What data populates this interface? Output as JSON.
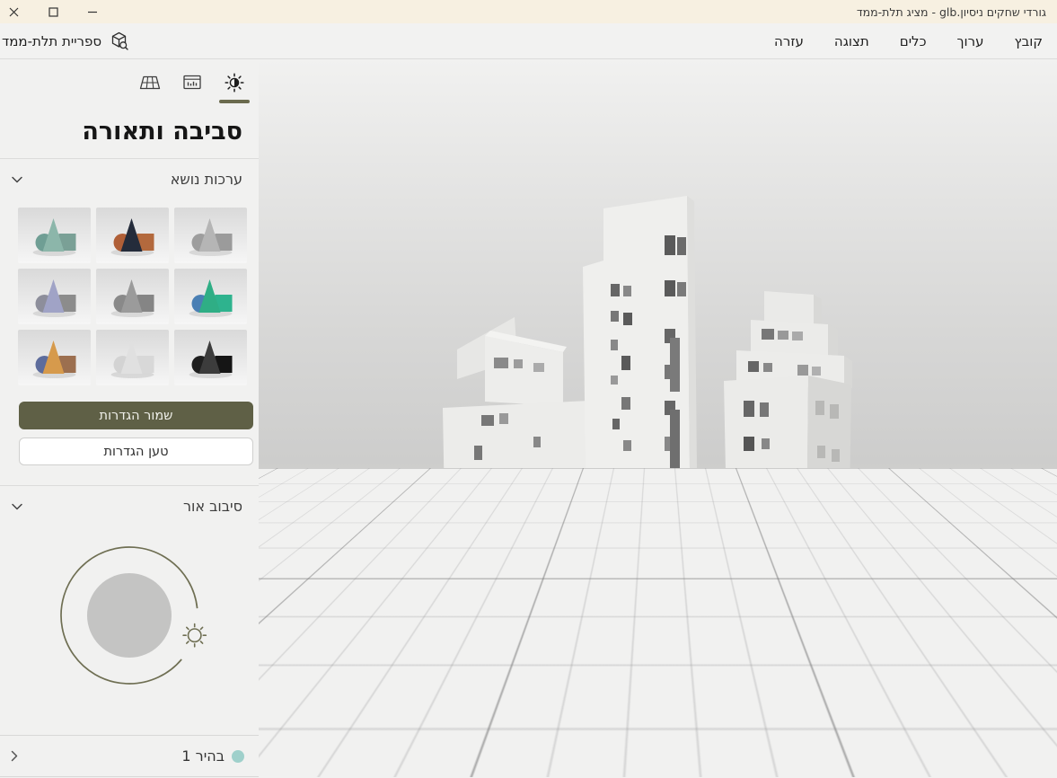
{
  "window": {
    "title": "גורדי שחקים ניסיון.glb - מציג תלת-ממד",
    "titlebar_color": "#f7f0e1"
  },
  "menubar": {
    "items": [
      {
        "label": "קובץ"
      },
      {
        "label": "ערוך"
      },
      {
        "label": "כלים"
      },
      {
        "label": "תצוגה"
      },
      {
        "label": "עזרה"
      }
    ],
    "library_label": "ספריית תלת-ממד"
  },
  "sidebar": {
    "tabs": [
      {
        "name": "lighting",
        "icon": "sun-icon",
        "active": true
      },
      {
        "name": "stats",
        "icon": "stats-panel-icon",
        "active": false
      },
      {
        "name": "grid",
        "icon": "ground-grid-icon",
        "active": false
      }
    ],
    "title": "סביבה ותאורה",
    "themes": {
      "label": "ערכות נושא",
      "tiles": [
        {
          "name": "sage",
          "sphere": "#6f9e94",
          "cone": "#8cb6aa",
          "cube": "#7aa096"
        },
        {
          "name": "rust-navy",
          "sphere": "#b05f37",
          "cone": "#242c3b",
          "cube": "#b3693d"
        },
        {
          "name": "gray",
          "sphere": "#9d9d9d",
          "cone": "#b5b5b5",
          "cube": "#9b9b9b"
        },
        {
          "name": "lavender",
          "sphere": "#8d8e9b",
          "cone": "#a0a3c6",
          "cube": "#8c8c8c"
        },
        {
          "name": "dark-gray",
          "sphere": "#898989",
          "cone": "#9b9b9b",
          "cube": "#858585"
        },
        {
          "name": "green",
          "sphere": "#4a7fb4",
          "cone": "#2fae85",
          "cube": "#2eb38e"
        },
        {
          "name": "amber",
          "sphere": "#5d6c9c",
          "cone": "#d69a4c",
          "cube": "#9c6f4f"
        },
        {
          "name": "white",
          "sphere": "#d3d3d3",
          "cone": "#e0e0e0",
          "cube": "#d8d8d8"
        },
        {
          "name": "black",
          "sphere": "#1f1f1f",
          "cone": "#3c3c3c",
          "cube": "#151515"
        }
      ]
    },
    "save_button": "שמור הגדרות",
    "load_button": "טען הגדרות",
    "light_rotation": {
      "label": "סיבוב אור"
    },
    "preset": {
      "label": "בהיר 1",
      "dot_color": "#9fd0cb"
    }
  },
  "colors": {
    "accent_olive": "#5f6046",
    "dial_ring": "#6f6f53",
    "active_tab_underline": "#6b6b4e",
    "teal_dot": "#9fd0cb"
  }
}
